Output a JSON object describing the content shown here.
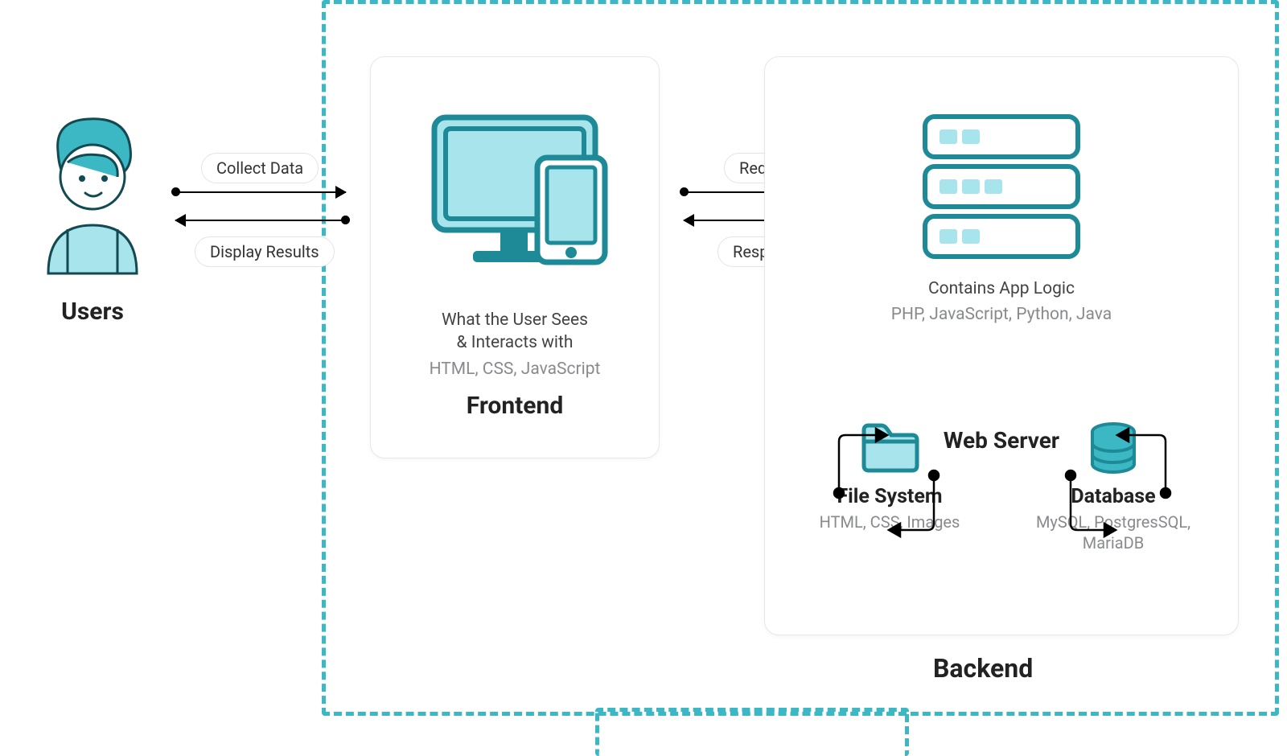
{
  "colors": {
    "accent": "#3cb8c5",
    "accent_light": "#a8e4eb"
  },
  "users": {
    "title": "Users"
  },
  "arrows": {
    "collect": "Collect Data",
    "display": "Display Results",
    "request": "Request",
    "response": "Response"
  },
  "frontend": {
    "desc_line1": "What the User Sees",
    "desc_line2": "& Interacts with",
    "tech": "HTML, CSS, JavaScript",
    "title": "Frontend"
  },
  "backend": {
    "desc": "Contains App Logic",
    "tech": "PHP, JavaScript, Python, Java",
    "web_server": "Web Server",
    "file_system": {
      "title": "File System",
      "tech": "HTML, CSS, Images"
    },
    "database": {
      "title": "Database",
      "tech": "MySQL, PostgresSQL, MariaDB"
    },
    "title": "Backend"
  }
}
